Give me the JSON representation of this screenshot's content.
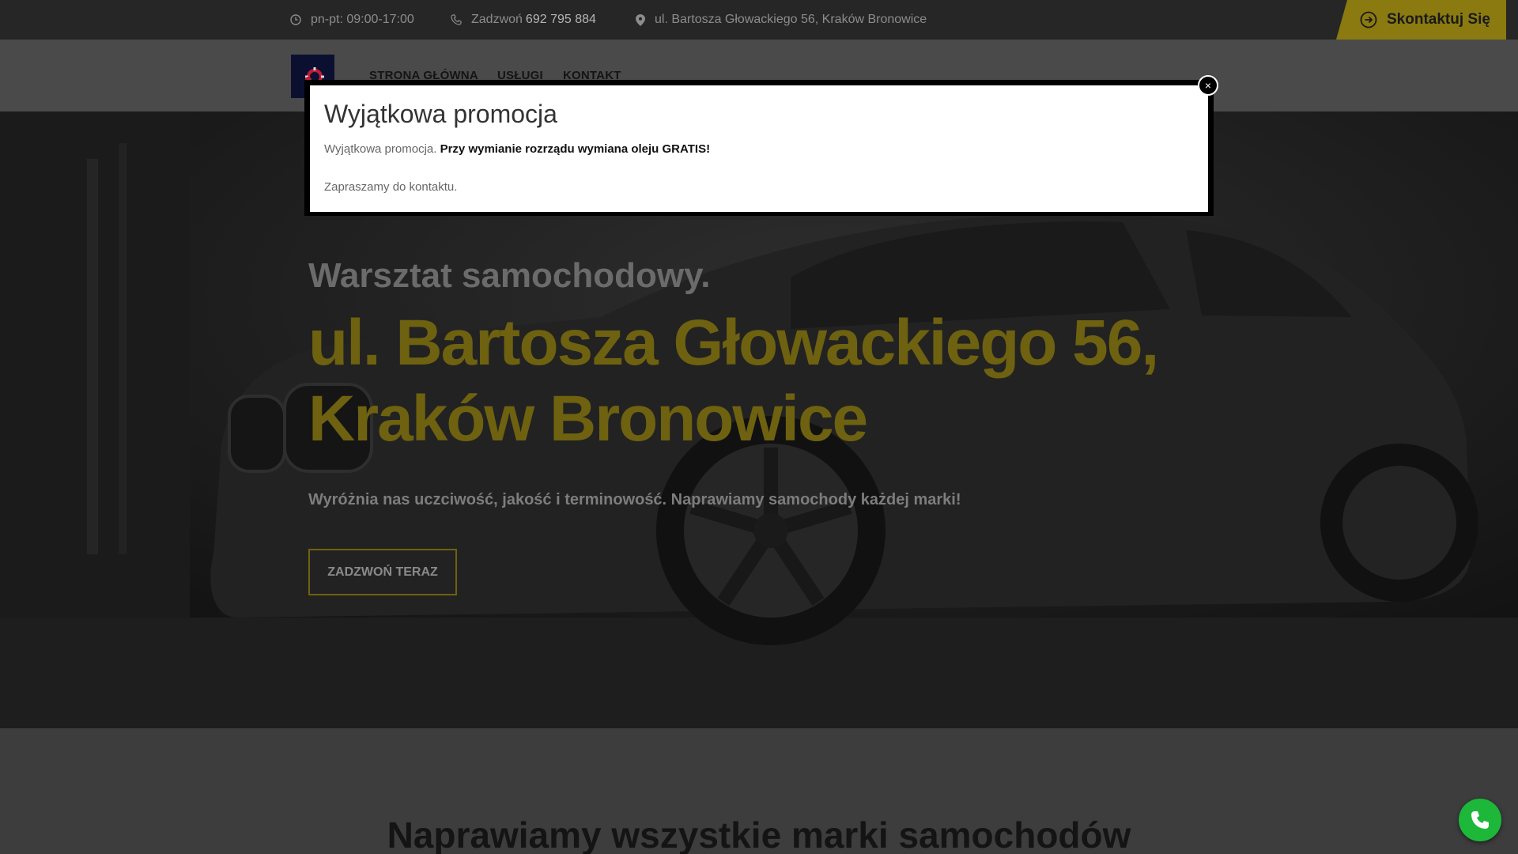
{
  "topbar": {
    "hours": "pn-pt: 09:00-17:00",
    "phone_prefix": "Zadzwoń",
    "phone_number": "692 795 884",
    "address": "ul. Bartosza Głowackiego 56, Kraków Bronowice",
    "contact_button": "Skontaktuj Się"
  },
  "nav": {
    "items": [
      {
        "label": "STRONA GŁÓWNA"
      },
      {
        "label": "USŁUGI"
      },
      {
        "label": "KONTAKT"
      }
    ]
  },
  "hero": {
    "subtitle": "Warsztat samochodowy.",
    "title_line1": "ul. Bartosza Głowackiego 56,",
    "title_line2": "Kraków Bronowice",
    "description": "Wyróżnia nas uczciwość, jakość i terminowość. Naprawiamy samochody każdej marki!",
    "cta": "ZADZWOŃ TERAZ"
  },
  "section": {
    "title": "Naprawiamy wszystkie marki samochodów"
  },
  "modal": {
    "title": "Wyjątkowa promocja",
    "text_plain": "Wyjątkowa promocja.",
    "text_bold": "Przy wymianie rozrządu wymiana oleju GRATIS!",
    "text_invite": "Zapraszamy do kontaktu.",
    "close": "×"
  },
  "colors": {
    "accent": "#8a7a10",
    "topbar_bg": "#262626",
    "call_button": "#1db83a"
  }
}
